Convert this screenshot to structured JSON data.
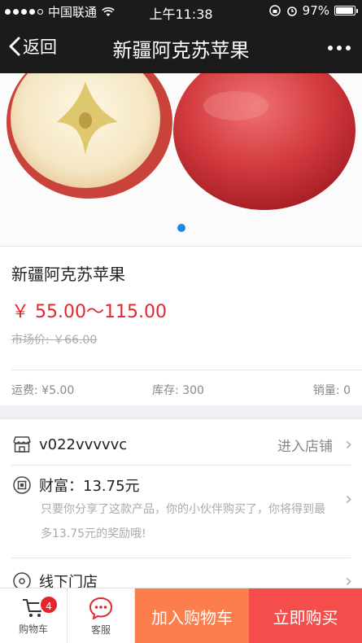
{
  "status_bar": {
    "carrier": "中国联通",
    "time": "上午11:38",
    "battery": "97%",
    "battery_level": 0.97
  },
  "nav": {
    "back_label": "返回",
    "title": "新疆阿克苏苹果"
  },
  "product": {
    "name": "新疆阿克苏苹果",
    "price": "￥ 55.00～115.00",
    "market_price": "市场价: ￥66.00",
    "shipping": "运费: ¥5.00",
    "stock": "库存: 300",
    "sales": "销量: 0"
  },
  "shop": {
    "name": "v022vvvvvc",
    "enter_label": "进入店铺",
    "wealth_label": "财富：13.75元",
    "wealth_desc": "只要你分享了这款产品，你的小伙伴购买了，你将得到最多13.75元的奖励哦!",
    "offline_label": "线下门店"
  },
  "bottom_bar": {
    "cart_label": "购物车",
    "cart_count": "4",
    "service_label": "客服",
    "add_cart_label": "加入购物车",
    "buy_label": "立即购买"
  },
  "colors": {
    "accent_red": "#e4262c",
    "orange": "#fb7e4c",
    "buy_red": "#f54c4c",
    "service_blue": "#2196f3"
  },
  "icons": [
    "back-chevron-icon",
    "more-icon",
    "store-icon",
    "wealth-icon",
    "location-icon",
    "cart-icon",
    "chat-icon"
  ]
}
